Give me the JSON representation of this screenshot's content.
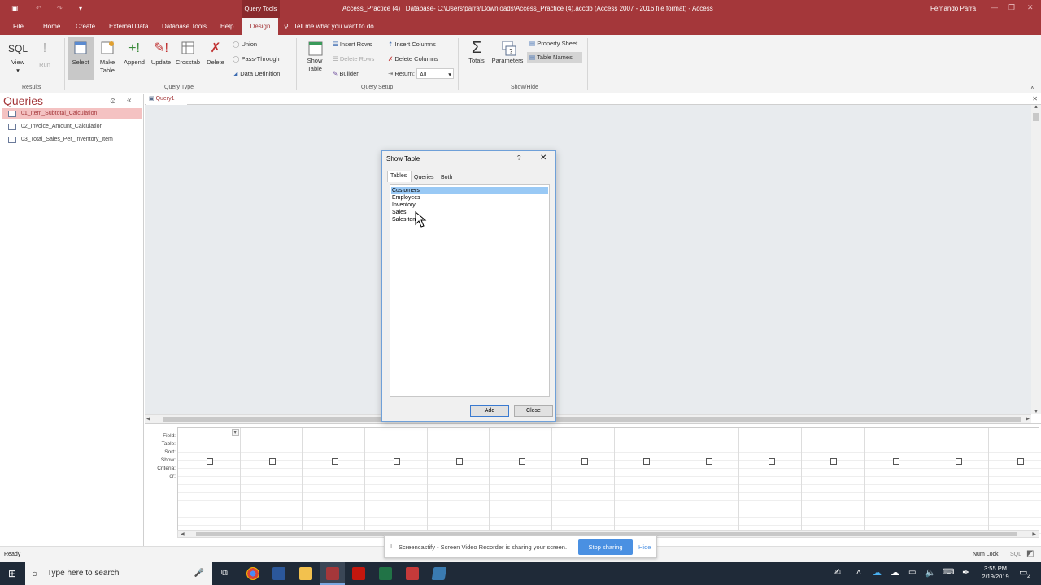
{
  "titlebar": {
    "title": "Access_Practice (4) : Database- C:\\Users\\parra\\Downloads\\Access_Practice (4).accdb (Access 2007 - 2016 file format)  -  Access",
    "context_tab": "Query Tools",
    "user": "Fernando Parra"
  },
  "tabs": [
    "File",
    "Home",
    "Create",
    "External Data",
    "Database Tools",
    "Help",
    "Design"
  ],
  "tell_me": "Tell me what you want to do",
  "ribbon": {
    "results": {
      "sql": "SQL",
      "view": "View",
      "run": "Run",
      "group": "Results"
    },
    "query_type": {
      "select": "Select",
      "make_table_1": "Make",
      "make_table_2": "Table",
      "append": "Append",
      "update": "Update",
      "crosstab": "Crosstab",
      "delete": "Delete",
      "union": "Union",
      "pass_through": "Pass-Through",
      "data_definition": "Data Definition",
      "group": "Query Type"
    },
    "query_setup": {
      "show_table_1": "Show",
      "show_table_2": "Table",
      "insert_rows": "Insert Rows",
      "delete_rows": "Delete Rows",
      "builder": "Builder",
      "insert_columns": "Insert Columns",
      "delete_columns": "Delete Columns",
      "return_label": "Return:",
      "return_value": "All",
      "group": "Query Setup"
    },
    "show_hide": {
      "totals": "Totals",
      "parameters": "Parameters",
      "property_sheet": "Property Sheet",
      "table_names": "Table Names",
      "group": "Show/Hide"
    }
  },
  "nav": {
    "header": "Queries",
    "items": [
      "01_Item_Subtotal_Calculation",
      "02_Invoice_Amount_Calculation",
      "03_Total_Sales_Per_Inventory_Item"
    ]
  },
  "doc_tab": "Query1",
  "grid": {
    "row_labels": [
      "Field:",
      "Table:",
      "Sort:",
      "Show:",
      "Criteria:",
      "or:"
    ]
  },
  "dialog": {
    "title": "Show Table",
    "help": "?",
    "tabs": [
      "Tables",
      "Queries",
      "Both"
    ],
    "items": [
      "Customers",
      "Employees",
      "Inventory",
      "Sales",
      "SalesItem"
    ],
    "add": "Add",
    "close": "Close"
  },
  "screencastify": {
    "message": "Screencastify - Screen Video Recorder is sharing your screen.",
    "stop": "Stop sharing",
    "hide": "Hide"
  },
  "status": {
    "left": "Ready",
    "numlock": "Num Lock",
    "sql": "SQL"
  },
  "taskbar": {
    "search_placeholder": "Type here to search",
    "time": "3:55 PM",
    "date": "2/19/2019",
    "notifications": "2"
  },
  "colors": {
    "accent": "#a4373a",
    "selection": "#99c9f5",
    "stop_button": "#4a90e2"
  }
}
